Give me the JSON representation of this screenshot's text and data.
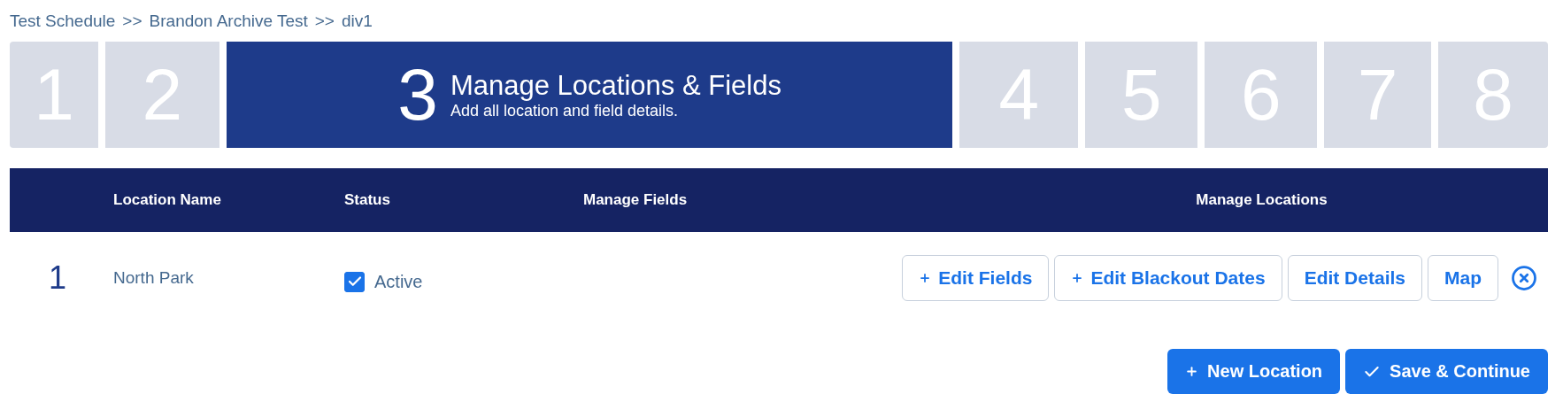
{
  "breadcrumb": [
    {
      "label": "Test Schedule"
    },
    {
      "label": "Brandon Archive Test"
    },
    {
      "label": "div1"
    }
  ],
  "breadcrumb_separator": ">>",
  "steps": [
    {
      "number": "1",
      "selected": false
    },
    {
      "number": "2",
      "selected": false
    },
    {
      "number": "3",
      "selected": true,
      "title": "Manage Locations & Fields",
      "subtitle": "Add all location and field details."
    },
    {
      "number": "4",
      "selected": false
    },
    {
      "number": "5",
      "selected": false
    },
    {
      "number": "6",
      "selected": false
    },
    {
      "number": "7",
      "selected": false
    },
    {
      "number": "8",
      "selected": false
    }
  ],
  "table": {
    "columns": [
      "Location Name",
      "Status",
      "Manage Fields",
      "Manage Locations"
    ],
    "rows": [
      {
        "index": "1",
        "name": "North Park",
        "status": {
          "label": "Active",
          "checked": true
        },
        "actions": [
          {
            "label": "Edit Fields",
            "kind": "plus"
          },
          {
            "label": "Edit Blackout Dates",
            "kind": "plus"
          },
          {
            "label": "Edit Details",
            "kind": "plain"
          },
          {
            "label": "Map",
            "kind": "plain"
          }
        ]
      }
    ]
  },
  "footer_buttons": [
    {
      "label": "New Location",
      "kind": "plus"
    },
    {
      "label": "Save & Continue",
      "kind": "check"
    }
  ]
}
